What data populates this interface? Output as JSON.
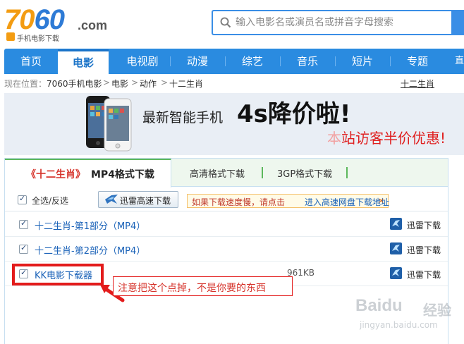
{
  "logo": {
    "text_main_a": "70",
    "text_main_b": "60",
    "domain_suffix": ".com",
    "tagline": "手机电影下载"
  },
  "search": {
    "placeholder": "输入电影名或演员名或拼音字母搜索"
  },
  "nav": {
    "items": [
      {
        "label": "首页",
        "active": false
      },
      {
        "label": "电影",
        "active": true
      },
      {
        "label": "电视剧",
        "active": false
      },
      {
        "label": "动漫",
        "active": false
      },
      {
        "label": "综艺",
        "active": false
      },
      {
        "label": "音乐",
        "active": false
      },
      {
        "label": "短片",
        "active": false
      },
      {
        "label": "专题",
        "active": false
      },
      {
        "label": "直播",
        "active": false
      }
    ]
  },
  "breadcrumb": {
    "prefix": "现在位置：",
    "items": [
      "7060手机电影",
      "电影",
      "动作",
      "十二生肖"
    ],
    "separator": ">",
    "right_link": "十二生肖"
  },
  "banner": {
    "line1": "最新智能手机",
    "line2": "4s降价啦!",
    "line3_prefix": "本",
    "line3_rest": "站访客半价优惠!"
  },
  "tabs": {
    "active_title": "《十二生肖》",
    "active_suffix": "MP4格式下载",
    "others": [
      "高清格式下载",
      "3GP格式下载"
    ]
  },
  "toolbar": {
    "select_all": "全选/反选",
    "xunlei_button": "迅雷高速下载",
    "notice_text": "如果下载速度慢，请点击",
    "notice_link": "进入高速网盘下载地址",
    "notice_close": "×"
  },
  "files": [
    {
      "name": "十二生肖-第1部分（MP4）",
      "size": "",
      "action": "迅雷下载",
      "checked": true
    },
    {
      "name": "十二生肖-第2部分（MP4）",
      "size": "",
      "action": "迅雷下载",
      "checked": true
    },
    {
      "name": "KK电影下载器",
      "size": "961KB",
      "action": "迅雷下载",
      "checked": true
    }
  ],
  "annotation": {
    "callout": "注意把这个点掉，不是你要的东西"
  },
  "watermark": {
    "brand": "Baidu",
    "cn": "经验",
    "url": "jingyan.baidu.com"
  },
  "colors": {
    "nav_blue": "#2a8be0",
    "accent_red": "#e31b1b",
    "link_blue": "#1a62b8",
    "tab_green": "#5cb85c"
  }
}
